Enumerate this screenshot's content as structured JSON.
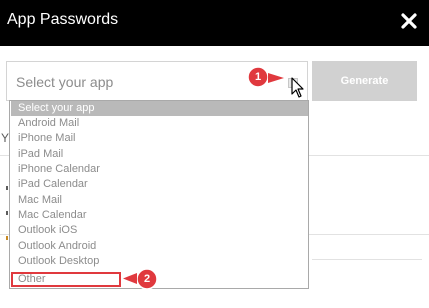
{
  "window": {
    "title": "App Passwords",
    "close_icon": "close-icon"
  },
  "form": {
    "select_value": "Select your app",
    "generate_label": "Generate"
  },
  "background": {
    "tab_initial": "Y"
  },
  "dropdown": {
    "options": [
      {
        "label": "Select your app",
        "selected": true
      },
      {
        "label": "Android Mail"
      },
      {
        "label": "iPhone Mail"
      },
      {
        "label": "iPad Mail"
      },
      {
        "label": "iPhone Calendar"
      },
      {
        "label": "iPad Calendar"
      },
      {
        "label": "Mac Mail"
      },
      {
        "label": "Mac Calendar"
      },
      {
        "label": "Outlook iOS"
      },
      {
        "label": "Outlook Android"
      },
      {
        "label": "Outlook Desktop"
      },
      {
        "label": "Other"
      }
    ]
  },
  "annotations": {
    "callout_1": "1",
    "callout_2": "2",
    "color": "#e0393e"
  },
  "colors": {
    "header_bg": "#000000",
    "button_bg": "#d1d1d1",
    "selected_option_bg": "#b9b9b9",
    "text_gray": "#8c8c8c"
  }
}
